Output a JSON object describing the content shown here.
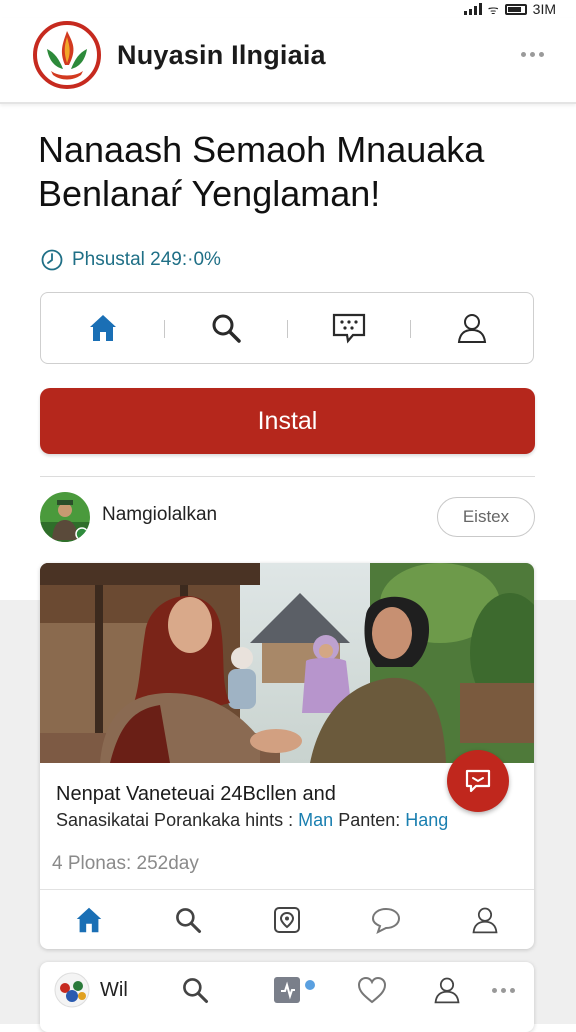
{
  "status_bar": {
    "network": "3IM"
  },
  "header": {
    "title": "Nuyasin Ilngiaia",
    "logo_icon": "flame-emblem-logo",
    "menu_icon": "more-dots-icon"
  },
  "headline": {
    "line1": "Nanaash Semaoh Mnauaka",
    "line2": "Benlanaŕ Yenglaman!"
  },
  "progress": {
    "text": "Phsustal 249:·0%",
    "icon": "clock-icon"
  },
  "icon_bar": {
    "items": [
      "home-icon",
      "search-icon",
      "chat-icon",
      "profile-icon"
    ],
    "active": "home-icon"
  },
  "install": {
    "label": "Instal"
  },
  "author": {
    "name": "Namgiolalkan",
    "follow_label": "Eistex",
    "avatar_icon": "author-avatar"
  },
  "card": {
    "title": "Nenpat Vaneteuai 24Bcllen and",
    "subtitle_prefix": "Sanasikatai Porankaka hints :",
    "subtitle_link1": "Man",
    "subtitle_mid": "Panten:",
    "subtitle_link2": "Hang",
    "meta": "4 Plonas:  252day",
    "tabs": [
      "home-icon",
      "search-icon",
      "location-icon",
      "comment-icon",
      "profile-icon"
    ]
  },
  "fab": {
    "icon": "comment-icon"
  },
  "bottom_nav": {
    "label": "Wil",
    "items": [
      "search-icon",
      "activity-icon",
      "heart-icon",
      "profile-icon",
      "more-icon"
    ]
  },
  "colors": {
    "accent": "#b5271c",
    "link": "#1a7fb0",
    "active_icon": "#1a6fb5"
  }
}
